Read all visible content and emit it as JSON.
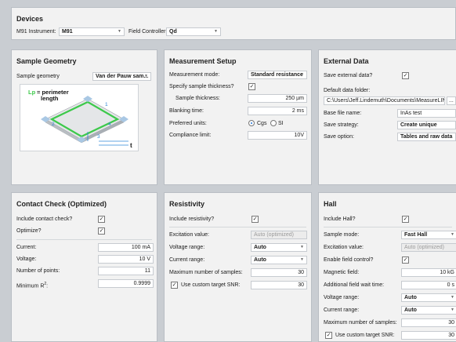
{
  "devices": {
    "title": "Devices",
    "instrument_label": "M91 Instrument:",
    "instrument_value": "M91",
    "controller_label": "Field Controller:",
    "controller_value": "Qd"
  },
  "geometry": {
    "title": "Sample Geometry",
    "label": "Sample geometry",
    "value": "Van der Pauw sam...",
    "legend_symbol": "Lp",
    "legend_line1": "= perimeter",
    "legend_line2": "length",
    "pt1": "1",
    "pt2": "2",
    "pt3": "3",
    "pt4": "4",
    "t_label": "t"
  },
  "measurement": {
    "title": "Measurement Setup",
    "mode_label": "Measurement mode:",
    "mode_value": "Standard resistance",
    "thickness_q_label": "Specify sample thickness?",
    "thickness_q_checked": true,
    "thickness_label": "Sample thickness:",
    "thickness_value": "250 µm",
    "blanking_label": "Blanking time:",
    "blanking_value": "2 ms",
    "units_label": "Preferred units:",
    "units_opt1": "Cgs",
    "units_opt2": "SI",
    "compliance_label": "Compliance limit:",
    "compliance_value": "10V"
  },
  "external": {
    "title": "External Data",
    "save_label": "Save external data?",
    "save_checked": true,
    "folder_label": "Default data folder:",
    "folder_value": "C:\\Users\\Jeff.Lindemuth\\Documents\\MeasureLINK",
    "browse_label": "...",
    "basefile_label": "Base file name:",
    "basefile_value": "InAs test",
    "strategy_label": "Save strategy:",
    "strategy_value": "Create unique",
    "option_label": "Save option:",
    "option_value": "Tables and raw data"
  },
  "contact": {
    "title": "Contact Check (Optimized)",
    "include_label": "Include contact check?",
    "include_checked": true,
    "optimize_label": "Optimize?",
    "optimize_checked": true,
    "current_label": "Current:",
    "current_value": "100 mA",
    "voltage_label": "Voltage:",
    "voltage_value": "10 V",
    "points_label": "Number of points:",
    "points_value": "11",
    "minr_label": "Minimum R",
    "minr_sup": "2",
    "minr_colon": ":",
    "minr_value": "0.9999"
  },
  "resistivity": {
    "title": "Resistivity",
    "include_label": "Include resistivity?",
    "include_checked": true,
    "excitation_label": "Excitation value:",
    "excitation_value": "Auto (optimized)",
    "vrange_label": "Voltage range:",
    "vrange_value": "Auto",
    "crange_label": "Current range:",
    "crange_value": "Auto",
    "maxsamples_label": "Maximum number of samples:",
    "maxsamples_value": "30",
    "snr_label": "Use custom target SNR:",
    "snr_checked": true,
    "snr_value": "30"
  },
  "hall": {
    "title": "Hall",
    "include_label": "Include Hall?",
    "include_checked": true,
    "mode_label": "Sample mode:",
    "mode_value": "Fast Hall",
    "excitation_label": "Excitation value:",
    "excitation_value": "Auto (optimized)",
    "fieldctl_label": "Enable field control?",
    "fieldctl_checked": true,
    "field_label": "Magnetic field:",
    "field_value": "10 kG",
    "wait_label": "Additional field wait time:",
    "wait_value": "0 s",
    "vrange_label": "Voltage range:",
    "vrange_value": "Auto",
    "crange_label": "Current range:",
    "crange_value": "Auto",
    "maxsamples_label": "Maximum number of samples:",
    "maxsamples_value": "30",
    "snr_label": "Use custom target SNR:",
    "snr_checked": true,
    "snr_value": "30"
  },
  "icons": {
    "check": "✓",
    "caret": "▼"
  },
  "colors": {
    "diagram_green": "#3cc94a",
    "diagram_blue": "#2f86d6",
    "contact_blue": "#a9c8e4"
  }
}
